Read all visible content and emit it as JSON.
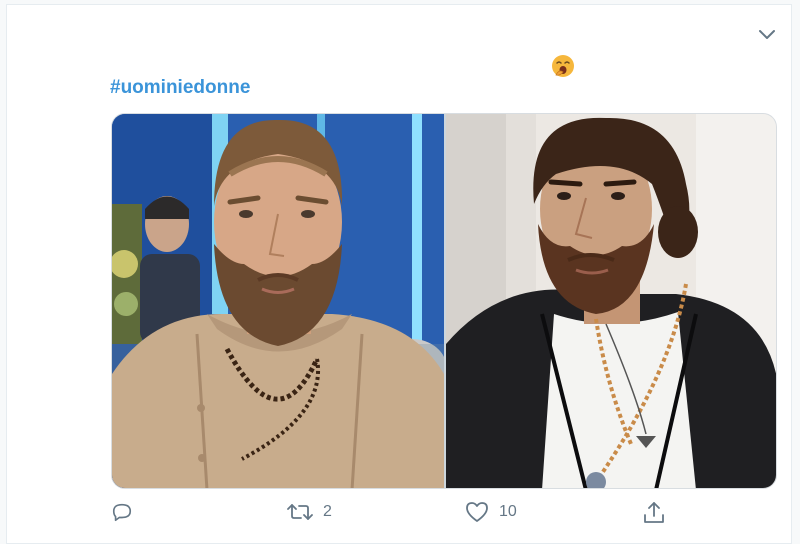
{
  "tweet": {
    "hashtag": "#uominiedonne",
    "emoji_icon": "yawning-face-icon",
    "menu_icon": "chevron-down-icon"
  },
  "media": {
    "images": [
      {
        "label": "man-with-beard-beige-shirt-photo"
      },
      {
        "label": "man-with-beard-black-jacket-photo"
      }
    ]
  },
  "actions": {
    "reply": {
      "icon": "reply-icon",
      "count": ""
    },
    "retweet": {
      "icon": "retweet-icon",
      "count": "2"
    },
    "like": {
      "icon": "heart-icon",
      "count": "10"
    },
    "share": {
      "icon": "share-icon",
      "count": ""
    }
  },
  "colors": {
    "hashtag": "#3b94d9",
    "icon": "#657786",
    "card_border": "#e6ecf0"
  }
}
